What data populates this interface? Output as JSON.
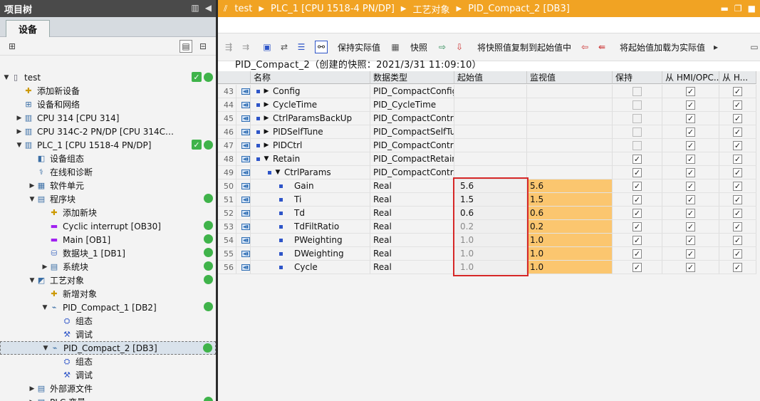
{
  "left": {
    "header_title": "项目树",
    "tab_label": "设备",
    "tree": [
      {
        "label": "test",
        "depth": 0,
        "arrow": "down",
        "icon": "project-icon",
        "status": [
          "check",
          "dot"
        ]
      },
      {
        "label": "添加新设备",
        "depth": 1,
        "arrow": "",
        "icon": "add-device-icon",
        "status": []
      },
      {
        "label": "设备和网络",
        "depth": 1,
        "arrow": "",
        "icon": "network-icon",
        "status": []
      },
      {
        "label": "CPU 314 [CPU 314]",
        "depth": 1,
        "arrow": "right",
        "icon": "cpu-icon",
        "status": []
      },
      {
        "label": "CPU 314C-2 PN/DP [CPU 314C-2 PN...",
        "depth": 1,
        "arrow": "right",
        "icon": "cpu-icon",
        "status": []
      },
      {
        "label": "PLC_1 [CPU 1518-4 PN/DP]",
        "depth": 1,
        "arrow": "down",
        "icon": "cpu-icon",
        "status": [
          "check",
          "dot"
        ]
      },
      {
        "label": "设备组态",
        "depth": 2,
        "arrow": "",
        "icon": "device-config-icon",
        "status": []
      },
      {
        "label": "在线和诊断",
        "depth": 2,
        "arrow": "",
        "icon": "diagnostics-icon",
        "status": []
      },
      {
        "label": "软件单元",
        "depth": 2,
        "arrow": "right",
        "icon": "software-unit-icon",
        "status": []
      },
      {
        "label": "程序块",
        "depth": 2,
        "arrow": "down",
        "icon": "program-blocks-icon",
        "status": [
          "dot"
        ]
      },
      {
        "label": "添加新块",
        "depth": 3,
        "arrow": "",
        "icon": "add-block-icon",
        "status": []
      },
      {
        "label": "Cyclic interrupt [OB30]",
        "depth": 3,
        "arrow": "",
        "icon": "ob-icon",
        "status": [
          "dot"
        ]
      },
      {
        "label": "Main [OB1]",
        "depth": 3,
        "arrow": "",
        "icon": "ob-icon",
        "status": [
          "dot"
        ]
      },
      {
        "label": "数据块_1 [DB1]",
        "depth": 3,
        "arrow": "",
        "icon": "db-icon",
        "status": [
          "dot"
        ]
      },
      {
        "label": "系统块",
        "depth": 3,
        "arrow": "right",
        "icon": "system-blocks-icon",
        "status": [
          "dot"
        ]
      },
      {
        "label": "工艺对象",
        "depth": 2,
        "arrow": "down",
        "icon": "technology-objects-icon",
        "status": [
          "dot"
        ]
      },
      {
        "label": "新增对象",
        "depth": 3,
        "arrow": "",
        "icon": "add-object-icon",
        "status": []
      },
      {
        "label": "PID_Compact_1 [DB2]",
        "depth": 3,
        "arrow": "down",
        "icon": "pid-icon",
        "status": [
          "dot"
        ]
      },
      {
        "label": "组态",
        "depth": 4,
        "arrow": "",
        "icon": "configuration-icon",
        "status": []
      },
      {
        "label": "调试",
        "depth": 4,
        "arrow": "",
        "icon": "commissioning-icon",
        "status": []
      },
      {
        "label": "PID_Compact_2 [DB3]",
        "depth": 3,
        "arrow": "down",
        "icon": "pid-icon",
        "status": [
          "dot"
        ],
        "selected": true
      },
      {
        "label": "组态",
        "depth": 4,
        "arrow": "",
        "icon": "configuration-icon",
        "status": []
      },
      {
        "label": "调试",
        "depth": 4,
        "arrow": "",
        "icon": "commissioning-icon",
        "status": []
      },
      {
        "label": "外部源文件",
        "depth": 2,
        "arrow": "right",
        "icon": "external-source-icon",
        "status": []
      },
      {
        "label": "PLC 变量",
        "depth": 2,
        "arrow": "right",
        "icon": "plc-tags-icon",
        "status": [
          "dot"
        ]
      }
    ]
  },
  "right": {
    "breadcrumb": [
      "test",
      "PLC_1 [CPU 1518-4 PN/DP]",
      "工艺对象",
      "PID_Compact_2 [DB3]"
    ],
    "toolbar": {
      "keep_actual": "保持实际值",
      "snapshot": "快照",
      "copy_snapshot": "将快照值复制到起始值中",
      "load_start": "将起始值加载为实际值"
    },
    "snapshot_title": "PID_Compact_2（创建的快照：2021/3/31 11:09:10）",
    "columns": {
      "name": "名称",
      "datatype": "数据类型",
      "start": "起始值",
      "monitor": "监视值",
      "retain": "保持",
      "hmi": "从 HMI/OPC...",
      "h2": "从 H..."
    },
    "rows": [
      {
        "num": "43",
        "indent": 0,
        "arrow": "right",
        "name": "Config",
        "type": "PID_CompactConfig",
        "start": "",
        "monitor": "",
        "retain": "dis",
        "hmi": "on",
        "h2": "on"
      },
      {
        "num": "44",
        "indent": 0,
        "arrow": "right",
        "name": "CycleTime",
        "type": "PID_CycleTime",
        "start": "",
        "monitor": "",
        "retain": "dis",
        "hmi": "on",
        "h2": "on"
      },
      {
        "num": "45",
        "indent": 0,
        "arrow": "right",
        "name": "CtrlParamsBackUp",
        "type": "PID_CompactContr...",
        "start": "",
        "monitor": "",
        "retain": "dis",
        "hmi": "on",
        "h2": "on"
      },
      {
        "num": "46",
        "indent": 0,
        "arrow": "right",
        "name": "PIDSelfTune",
        "type": "PID_CompactSelfTu...",
        "start": "",
        "monitor": "",
        "retain": "dis",
        "hmi": "on",
        "h2": "on"
      },
      {
        "num": "47",
        "indent": 0,
        "arrow": "right",
        "name": "PIDCtrl",
        "type": "PID_CompactControl",
        "start": "",
        "monitor": "",
        "retain": "dis",
        "hmi": "on",
        "h2": "on"
      },
      {
        "num": "48",
        "indent": 0,
        "arrow": "down",
        "name": "Retain",
        "type": "PID_CompactRetain",
        "start": "",
        "monitor": "",
        "retain": "on",
        "hmi": "on",
        "h2": "on"
      },
      {
        "num": "49",
        "indent": 1,
        "arrow": "down",
        "name": "CtrlParams",
        "type": "PID_CompactContr...",
        "start": "",
        "monitor": "",
        "retain": "on",
        "hmi": "on",
        "h2": "on"
      },
      {
        "num": "50",
        "indent": 2,
        "arrow": "",
        "name": "Gain",
        "type": "Real",
        "start": "5.6",
        "monitor": "5.6",
        "retain": "on",
        "hmi": "on",
        "h2": "on"
      },
      {
        "num": "51",
        "indent": 2,
        "arrow": "",
        "name": "Ti",
        "type": "Real",
        "start": "1.5",
        "monitor": "1.5",
        "retain": "on",
        "hmi": "on",
        "h2": "on"
      },
      {
        "num": "52",
        "indent": 2,
        "arrow": "",
        "name": "Td",
        "type": "Real",
        "start": "0.6",
        "monitor": "0.6",
        "retain": "on",
        "hmi": "on",
        "h2": "on"
      },
      {
        "num": "53",
        "indent": 2,
        "arrow": "",
        "name": "TdFiltRatio",
        "type": "Real",
        "start": "0.2",
        "monitor": "0.2",
        "retain": "on",
        "hmi": "on",
        "h2": "on",
        "gray": true
      },
      {
        "num": "54",
        "indent": 2,
        "arrow": "",
        "name": "PWeighting",
        "type": "Real",
        "start": "1.0",
        "monitor": "1.0",
        "retain": "on",
        "hmi": "on",
        "h2": "on",
        "gray": true
      },
      {
        "num": "55",
        "indent": 2,
        "arrow": "",
        "name": "DWeighting",
        "type": "Real",
        "start": "1.0",
        "monitor": "1.0",
        "retain": "on",
        "hmi": "on",
        "h2": "on",
        "gray": true
      },
      {
        "num": "56",
        "indent": 2,
        "arrow": "",
        "name": "Cycle",
        "type": "Real",
        "start": "1.0",
        "monitor": "1.0",
        "retain": "on",
        "hmi": "on",
        "h2": "on",
        "gray": true
      }
    ]
  },
  "colors": {
    "accent": "#f1a323",
    "monitor_bg": "#fbc66f",
    "highlight_box": "#d62828",
    "status_green": "#3fb34a"
  }
}
